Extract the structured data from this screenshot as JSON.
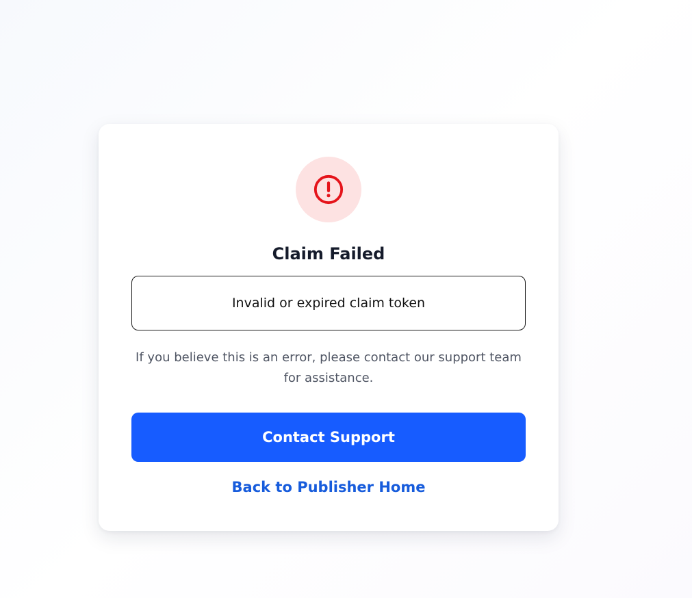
{
  "dialog": {
    "icon": "alert-circle-icon",
    "title": "Claim Failed",
    "error_message": "Invalid or expired claim token",
    "help_text": "If you believe this is an error, please contact our support team for assistance.",
    "primary_button": "Contact Support",
    "secondary_link": "Back to Publisher Home"
  },
  "colors": {
    "icon_red": "#e5141b",
    "icon_bg": "#fde2e2",
    "primary": "#175cff",
    "link": "#175cdc"
  }
}
